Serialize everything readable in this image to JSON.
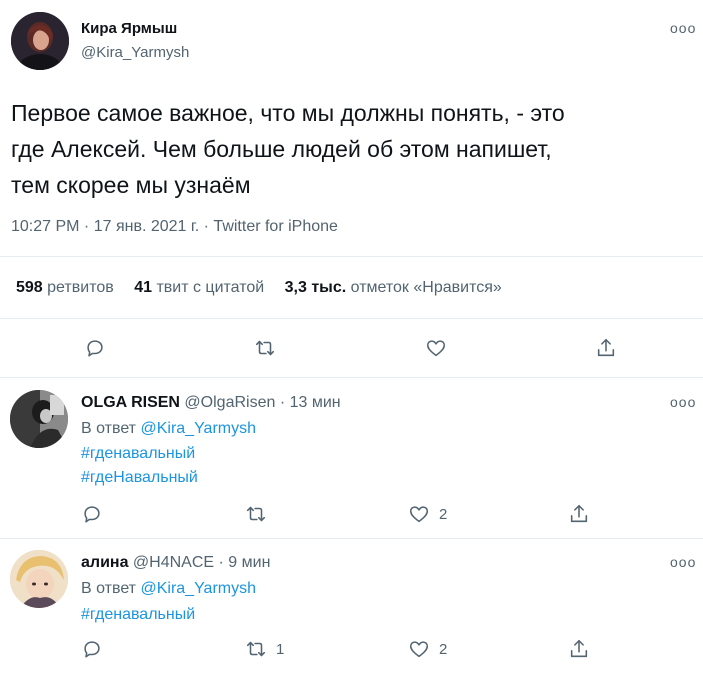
{
  "main_tweet": {
    "author_name": "Кира Ярмыш",
    "author_handle": "@Kira_Yarmysh",
    "more": "ooo",
    "text_line1": "Первое самое важное, что мы должны понять, - это",
    "text_line2": "где Алексей. Чем больше людей об этом напишет,",
    "text_line3": "тем скорее мы узнаём",
    "meta": "10:27 PM · 17 янв. 2021 г. · Twitter for iPhone",
    "stats": {
      "retweets_num": "598",
      "retweets_label": "ретвитов",
      "quotes_num": "41",
      "quotes_label": "твит с цитатой",
      "likes_num": "3,3 тыс.",
      "likes_label": "отметок «Нравится»"
    },
    "avatar_color": "#3a2a2e"
  },
  "replies": [
    {
      "author_name": "OLGA RISEN",
      "author_handle": "@OlgaRisen",
      "time": "· 13 мин",
      "more": "ooo",
      "reply_prefix": "В ответ",
      "reply_to": "@Kira_Yarmysh",
      "hashtag1": "#гденавальный",
      "hashtag2": "#гдеНавальный",
      "like_count": "2"
    },
    {
      "author_name": "алина",
      "author_handle": "@H4NACE",
      "time": "· 9 мин",
      "more": "ooo",
      "reply_prefix": "В ответ",
      "reply_to": "@Kira_Yarmysh",
      "hashtag1": "#гденавальный",
      "retweet_count": "1",
      "like_count": "2"
    }
  ],
  "colors": {
    "link": "#1b95e0",
    "secondary_text": "#536471",
    "divider": "#e6ecf0"
  }
}
